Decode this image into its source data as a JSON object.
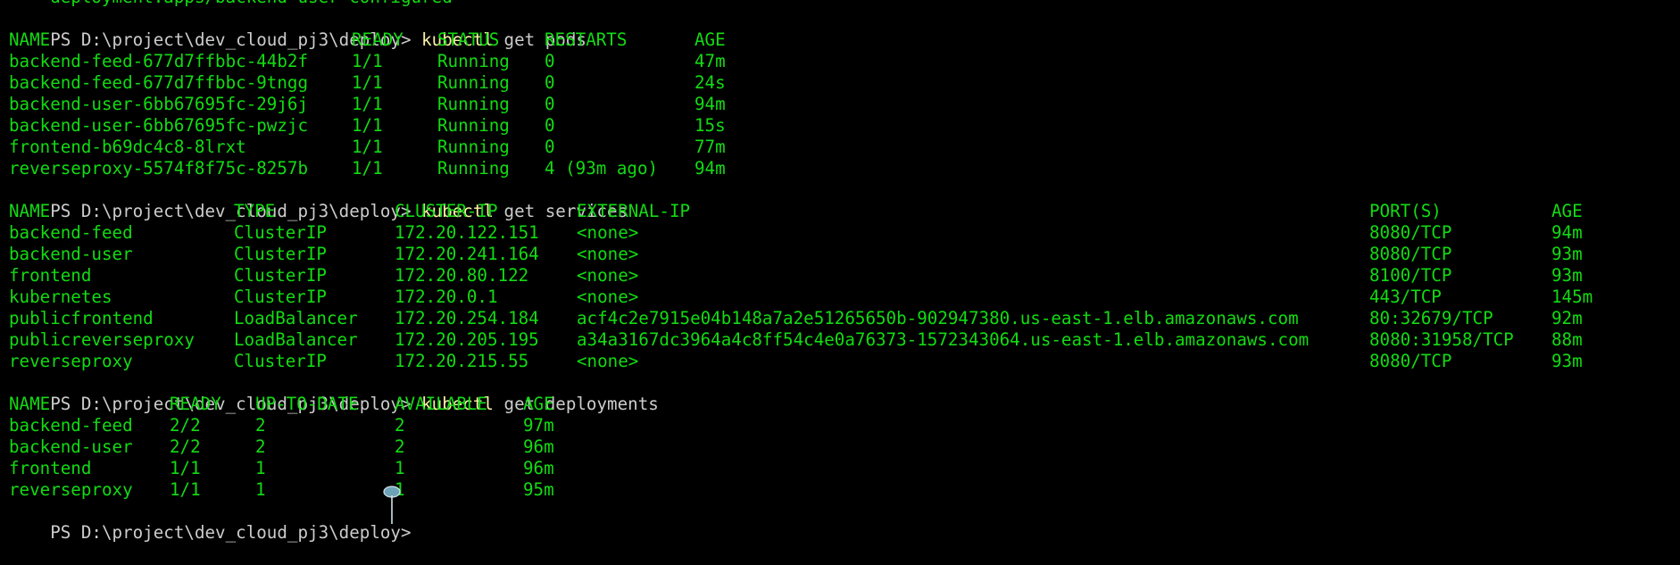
{
  "terminal": {
    "colors": {
      "background": "#000000",
      "output": "#13db13",
      "prompt": "#cccccc",
      "command": "#f9f1a5"
    },
    "top_partial_line": "deployment.apps/backend-user configured",
    "prompt": "PS D:\\project\\dev_cloud_pj3\\deploy> ",
    "pods": {
      "command_name": "kubectl",
      "command_args": " get pods",
      "headers": [
        "NAME",
        "READY",
        "STATUS",
        "RESTARTS",
        "AGE"
      ],
      "rows": [
        [
          "backend-feed-677d7ffbbc-44b2f",
          "1/1",
          "Running",
          "0",
          "47m"
        ],
        [
          "backend-feed-677d7ffbbc-9tngg",
          "1/1",
          "Running",
          "0",
          "24s"
        ],
        [
          "backend-user-6bb67695fc-29j6j",
          "1/1",
          "Running",
          "0",
          "94m"
        ],
        [
          "backend-user-6bb67695fc-pwzjc",
          "1/1",
          "Running",
          "0",
          "15s"
        ],
        [
          "frontend-b69dc4c8-8lrxt",
          "1/1",
          "Running",
          "0",
          "77m"
        ],
        [
          "reverseproxy-5574f8f75c-8257b",
          "1/1",
          "Running",
          "4 (93m ago)",
          "94m"
        ]
      ]
    },
    "services": {
      "command_name": "kubectl",
      "command_args": " get services",
      "headers": [
        "NAME",
        "TYPE",
        "CLUSTER-IP",
        "EXTERNAL-IP",
        "PORT(S)",
        "AGE"
      ],
      "rows": [
        [
          "backend-feed",
          "ClusterIP",
          "172.20.122.151",
          "<none>",
          "8080/TCP",
          "94m"
        ],
        [
          "backend-user",
          "ClusterIP",
          "172.20.241.164",
          "<none>",
          "8080/TCP",
          "93m"
        ],
        [
          "frontend",
          "ClusterIP",
          "172.20.80.122",
          "<none>",
          "8100/TCP",
          "93m"
        ],
        [
          "kubernetes",
          "ClusterIP",
          "172.20.0.1",
          "<none>",
          "443/TCP",
          "145m"
        ],
        [
          "publicfrontend",
          "LoadBalancer",
          "172.20.254.184",
          "acf4c2e7915e04b148a7a2e51265650b-902947380.us-east-1.elb.amazonaws.com",
          "80:32679/TCP",
          "92m"
        ],
        [
          "publicreverseproxy",
          "LoadBalancer",
          "172.20.205.195",
          "a34a3167dc3964a4c8ff54c4e0a76373-1572343064.us-east-1.elb.amazonaws.com",
          "8080:31958/TCP",
          "88m"
        ],
        [
          "reverseproxy",
          "ClusterIP",
          "172.20.215.55",
          "<none>",
          "8080/TCP",
          "93m"
        ]
      ]
    },
    "deployments": {
      "command_name": "kubectl",
      "command_args": " get deployments",
      "headers": [
        "NAME",
        "READY",
        "UP-TO-DATE",
        "AVAILABLE",
        "AGE"
      ],
      "rows": [
        [
          "backend-feed",
          "2/2",
          "2",
          "2",
          "97m"
        ],
        [
          "backend-user",
          "2/2",
          "2",
          "2",
          "96m"
        ],
        [
          "frontend",
          "1/1",
          "1",
          "1",
          "96m"
        ],
        [
          "reverseproxy",
          "1/1",
          "1",
          "1",
          "95m"
        ]
      ]
    },
    "cursor_icon": "text-cursor-icon"
  }
}
